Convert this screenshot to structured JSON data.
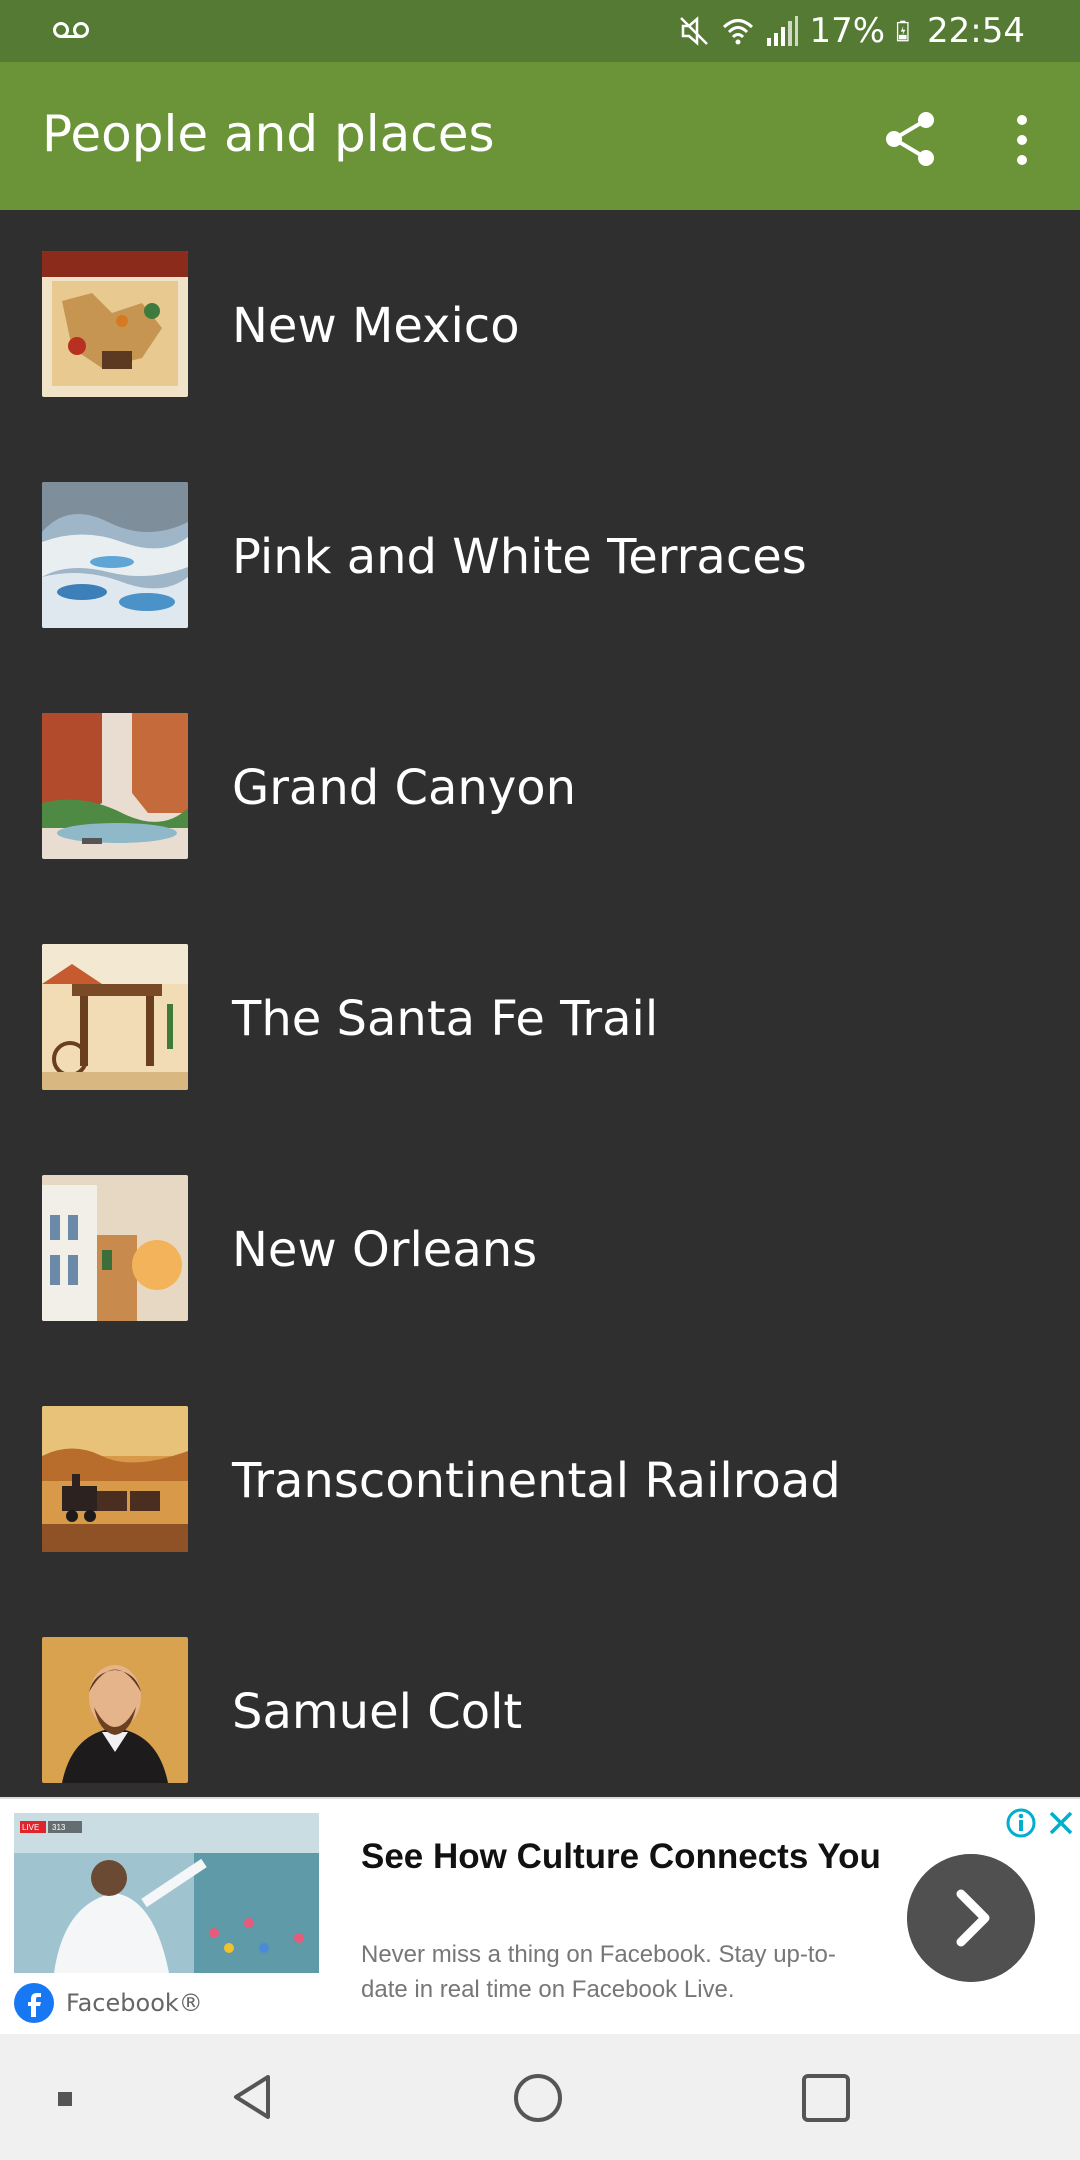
{
  "status_bar": {
    "battery": "17%",
    "time": "22:54",
    "icons": [
      "voicemail-icon",
      "mute-icon",
      "wifi-icon",
      "signal-icon",
      "battery-charging-icon"
    ]
  },
  "app_bar": {
    "title": "People and places",
    "share_icon": "share-icon",
    "menu_icon": "more-vert-icon"
  },
  "items": [
    {
      "label": "New Mexico"
    },
    {
      "label": "Pink and White Terraces"
    },
    {
      "label": "Grand Canyon"
    },
    {
      "label": "The Santa Fe Trail"
    },
    {
      "label": "New Orleans"
    },
    {
      "label": "Transcontinental Railroad"
    },
    {
      "label": "Samuel Colt"
    }
  ],
  "ad": {
    "title": "See How Culture Connects You",
    "description": "Never miss a thing on Facebook. Stay up-to-date in real time on Facebook Live.",
    "brand": "Facebook®",
    "live_badge": "LIVE",
    "viewer_count": "313",
    "colors": {
      "facebook_blue": "#1877f2",
      "ad_choices": "#00aecd"
    }
  },
  "colors": {
    "status_bar": "#557a34",
    "app_bar": "#6b9338",
    "list_background": "#2f2f2f"
  }
}
